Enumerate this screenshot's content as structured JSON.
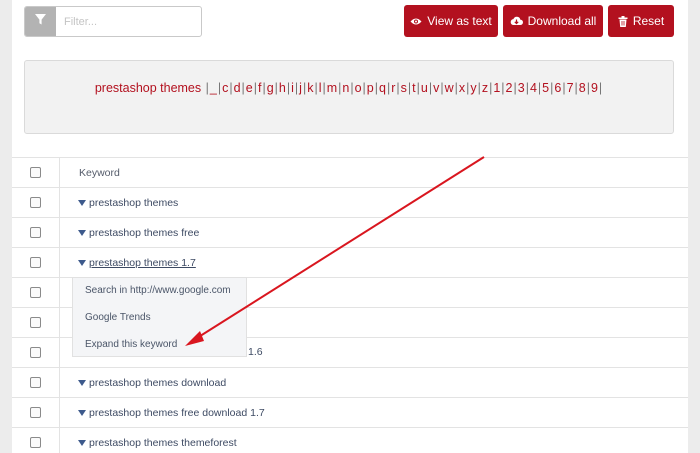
{
  "filter": {
    "placeholder": "Filter..."
  },
  "buttons": {
    "view_as_text": "View as text",
    "download_all": "Download all",
    "reset": "Reset"
  },
  "alphabet": {
    "first": "prestashop themes",
    "letters": [
      "_",
      "c",
      "d",
      "e",
      "f",
      "g",
      "h",
      "i",
      "j",
      "k",
      "l",
      "m",
      "n",
      "o",
      "p",
      "q",
      "r",
      "s",
      "t",
      "u",
      "v",
      "w",
      "x",
      "y",
      "z",
      "1",
      "2",
      "3",
      "4",
      "5",
      "6",
      "7",
      "8",
      "9"
    ]
  },
  "table": {
    "header": "Keyword",
    "rows": [
      "prestashop themes",
      "prestashop themes free",
      "prestashop themes 1.7",
      "",
      "",
      "1.6",
      "prestashop themes download",
      "prestashop themes free download 1.7",
      "prestashop themes themeforest"
    ]
  },
  "context_menu": {
    "items": [
      "Search in http://www.google.com",
      "Google Trends",
      "Expand this keyword"
    ]
  },
  "colors": {
    "accent": "#b3111f",
    "link": "#3d4a63"
  },
  "icons": {
    "filter": "filter-icon",
    "view": "eye-icon",
    "download": "cloud-download-icon",
    "reset": "trash-icon",
    "expand": "caret-down-icon"
  }
}
